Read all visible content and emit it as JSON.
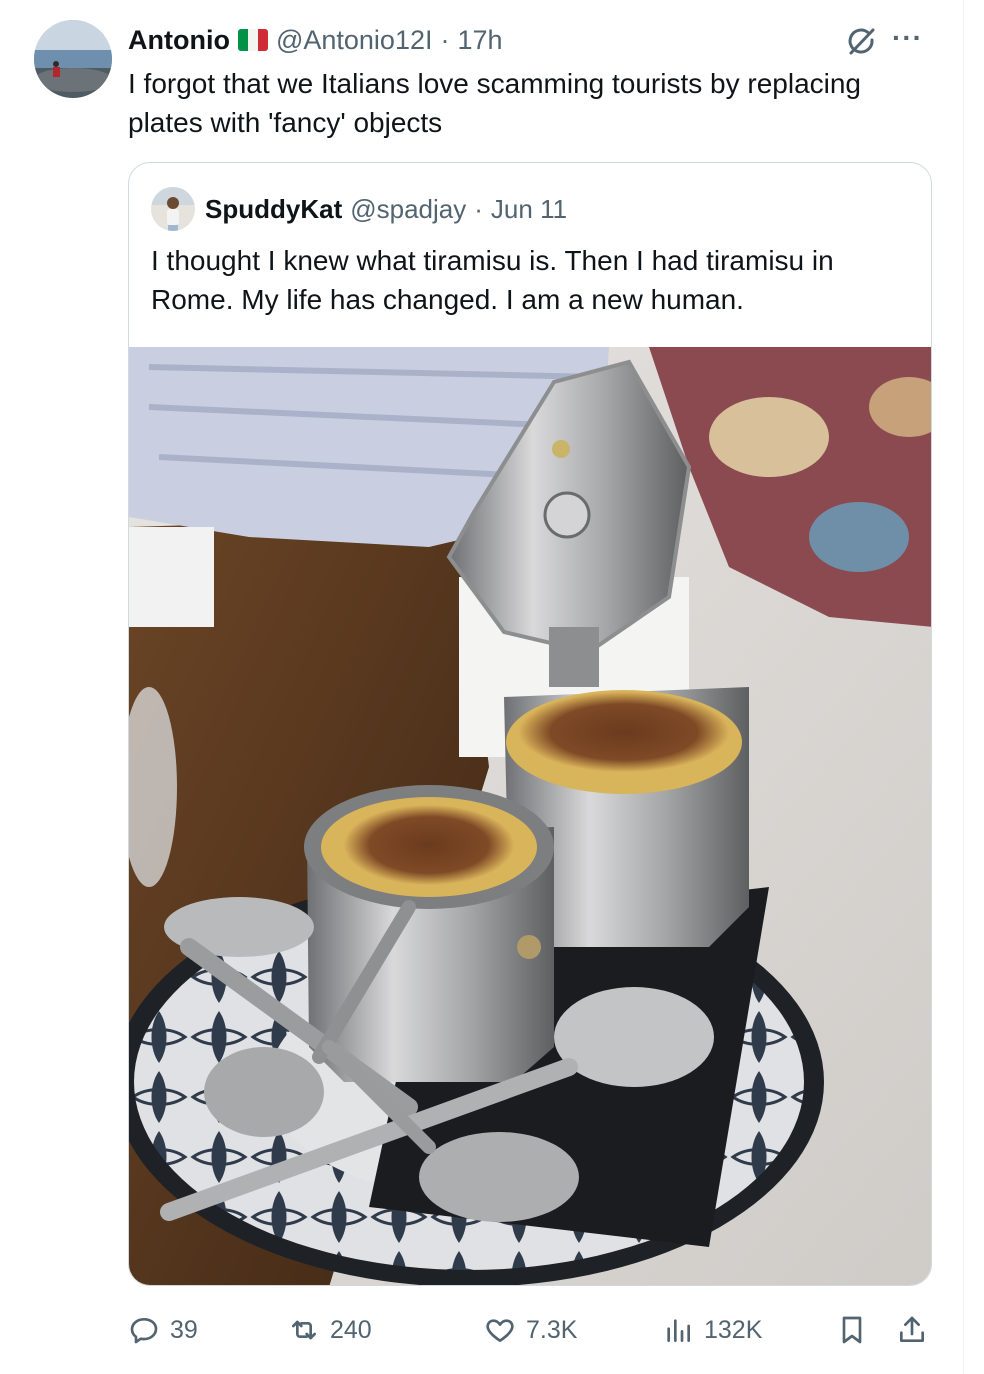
{
  "tweet": {
    "author": {
      "display_name": "Antonio",
      "flag_icon": "italy-flag-icon",
      "handle": "@Antonio12I",
      "separator": "·",
      "time": "17h"
    },
    "text": "I forgot that we Italians love scamming tourists by replacing plates with 'fancy' objects",
    "header_icons": [
      "grok-icon",
      "more-icon"
    ],
    "more_label": "···"
  },
  "quote": {
    "author": {
      "display_name": "SpuddyKat",
      "handle": "@spadjay",
      "separator": "·",
      "time": "Jun 11"
    },
    "text": "I thought I knew what tiramisu is. Then I had tiramisu in Rome. My life has changed. I am a new human.",
    "media_icon": "tiramisu-moka-pot-photo"
  },
  "actions": {
    "reply_count": "39",
    "retweet_count": "240",
    "like_count": "7.3K",
    "views_count": "132K",
    "icons": [
      "reply-icon",
      "retweet-icon",
      "like-icon",
      "views-icon",
      "bookmark-icon",
      "share-icon"
    ]
  },
  "colors": {
    "text_primary": "#0f1419",
    "text_secondary": "#536471",
    "border": "#cfd9de",
    "flag_green": "#009246",
    "flag_white": "#ffffff",
    "flag_red": "#ce2b37"
  }
}
